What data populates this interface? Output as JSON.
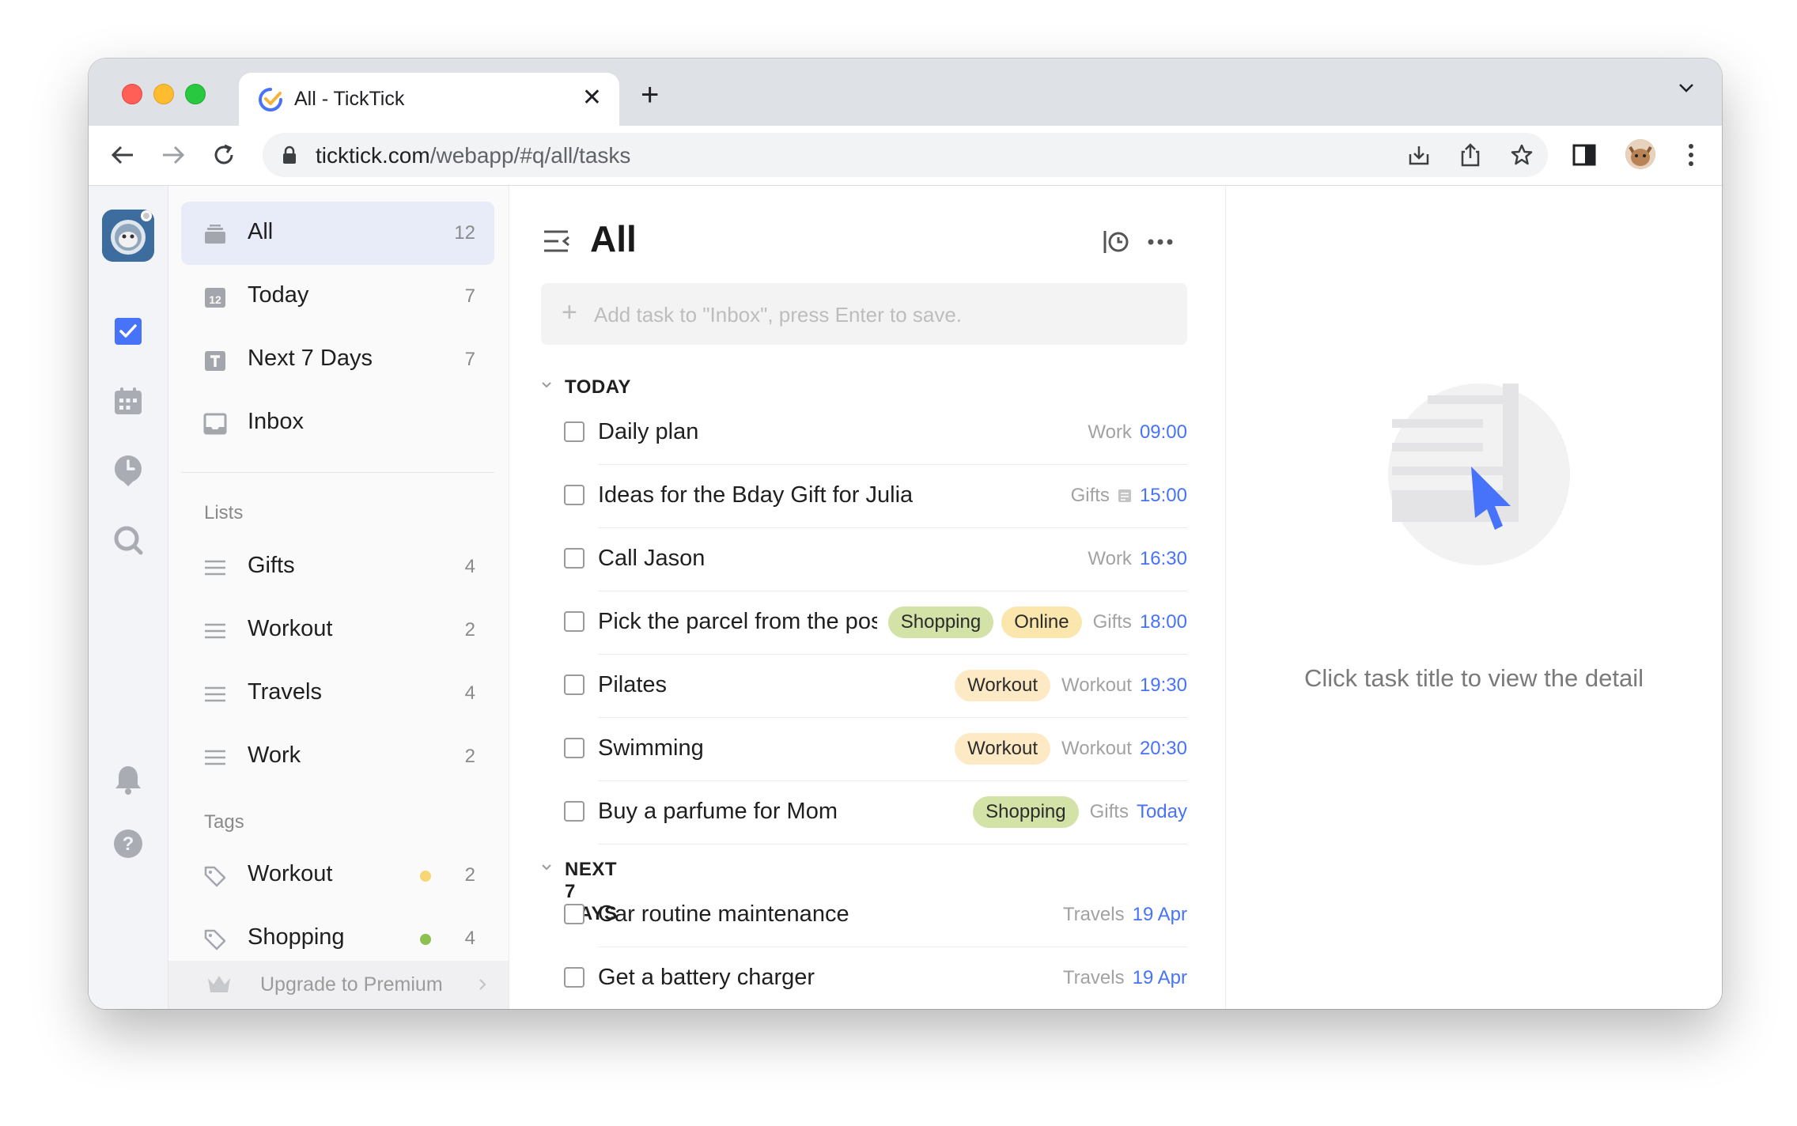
{
  "browser": {
    "tab_title": "All - TickTick",
    "url_host": "ticktick.com",
    "url_path": "/webapp/#q/all/tasks"
  },
  "sidebar": {
    "smart_lists": [
      {
        "label": "All",
        "count": "12",
        "active": true
      },
      {
        "label": "Today",
        "count": "7"
      },
      {
        "label": "Next 7 Days",
        "count": "7"
      },
      {
        "label": "Inbox",
        "count": ""
      }
    ],
    "lists_header": "Lists",
    "lists": [
      {
        "label": "Gifts",
        "count": "4"
      },
      {
        "label": "Workout",
        "count": "2"
      },
      {
        "label": "Travels",
        "count": "4"
      },
      {
        "label": "Work",
        "count": "2"
      }
    ],
    "tags_header": "Tags",
    "tags": [
      {
        "label": "Workout",
        "count": "2",
        "color": "#f7d774"
      },
      {
        "label": "Shopping",
        "count": "4",
        "color": "#8cc152"
      }
    ],
    "upgrade_label": "Upgrade to Premium",
    "today_icon_number": "12"
  },
  "main": {
    "title": "All",
    "add_placeholder": "Add task to \"Inbox\", press Enter to save.",
    "groups": [
      {
        "label": "TODAY",
        "tasks": [
          {
            "title": "Daily plan",
            "tags": [],
            "list": "Work",
            "note_icon": false,
            "time": "09:00"
          },
          {
            "title": "Ideas for the Bday Gift for Julia",
            "tags": [],
            "list": "Gifts",
            "note_icon": true,
            "time": "15:00"
          },
          {
            "title": "Call Jason",
            "tags": [],
            "list": "Work",
            "note_icon": false,
            "time": "16:30"
          },
          {
            "title": "Pick the parcel from the post office",
            "tags": [
              "Shopping",
              "Online"
            ],
            "list": "Gifts",
            "note_icon": false,
            "time": "18:00"
          },
          {
            "title": "Pilates",
            "tags": [
              "Workout"
            ],
            "list": "Workout",
            "note_icon": false,
            "time": "19:30"
          },
          {
            "title": "Swimming",
            "tags": [
              "Workout"
            ],
            "list": "Workout",
            "note_icon": false,
            "time": "20:30"
          },
          {
            "title": "Buy a parfume for Mom",
            "tags": [
              "Shopping"
            ],
            "list": "Gifts",
            "note_icon": false,
            "time": "Today"
          }
        ]
      },
      {
        "label": "NEXT 7 DAYS",
        "tasks": [
          {
            "title": "Car routine maintenance",
            "tags": [],
            "list": "Travels",
            "note_icon": false,
            "time": "19 Apr"
          },
          {
            "title": "Get a battery charger",
            "tags": [],
            "list": "Travels",
            "note_icon": false,
            "time": "19 Apr"
          }
        ]
      }
    ],
    "tag_colors": {
      "Shopping": "#d3e2a6",
      "Online": "#fbe7ad",
      "Workout": "#fdeac5"
    }
  },
  "detail": {
    "empty_text": "Click task title to view the detail"
  },
  "colors": {
    "accent": "#4772fa"
  }
}
